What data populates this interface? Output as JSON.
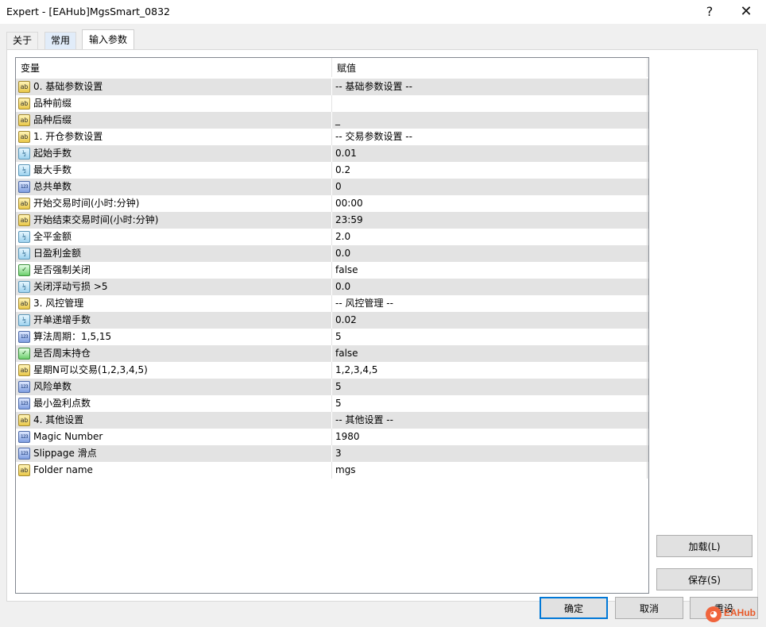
{
  "window": {
    "title": "Expert - [EAHub]MgsSmart_0832",
    "help_glyph": "?",
    "close_glyph": "✕"
  },
  "tabs": [
    {
      "label": "关于"
    },
    {
      "label": "常用"
    },
    {
      "label": "输入参数"
    }
  ],
  "grid": {
    "columns": {
      "variable": "变量",
      "value": "赋值"
    },
    "rows": [
      {
        "type": "string",
        "icon": "ab-icon",
        "name": "0. 基础参数设置",
        "value": "-- 基础参数设置 --"
      },
      {
        "type": "string",
        "icon": "ab-icon",
        "name": "品种前缀",
        "value": ""
      },
      {
        "type": "string",
        "icon": "ab-icon",
        "name": "品种后缀",
        "value": "_"
      },
      {
        "type": "string",
        "icon": "ab-icon",
        "name": "1. 开仓参数设置",
        "value": "-- 交易参数设置 --"
      },
      {
        "type": "double",
        "icon": "double-icon",
        "name": "起始手数",
        "value": "0.01"
      },
      {
        "type": "double",
        "icon": "double-icon",
        "name": "最大手数",
        "value": "0.2"
      },
      {
        "type": "int",
        "icon": "int-icon",
        "name": "总共单数",
        "value": "0"
      },
      {
        "type": "string",
        "icon": "ab-icon",
        "name": "开始交易时间(小时:分钟)",
        "value": "00:00"
      },
      {
        "type": "string",
        "icon": "ab-icon",
        "name": "开始结束交易时间(小时:分钟)",
        "value": "23:59"
      },
      {
        "type": "double",
        "icon": "double-icon",
        "name": "全平金额",
        "value": "2.0"
      },
      {
        "type": "double",
        "icon": "double-icon",
        "name": "日盈利金额",
        "value": "0.0"
      },
      {
        "type": "bool",
        "icon": "bool-icon",
        "name": "是否强制关闭",
        "value": "false"
      },
      {
        "type": "double",
        "icon": "double-icon",
        "name": "关闭浮动亏损 >5",
        "value": "0.0"
      },
      {
        "type": "string",
        "icon": "ab-icon",
        "name": "3. 风控管理",
        "value": "-- 风控管理 --"
      },
      {
        "type": "double",
        "icon": "double-icon",
        "name": "开单递增手数",
        "value": "0.02"
      },
      {
        "type": "int",
        "icon": "int-icon",
        "name": "算法周期：1,5,15",
        "value": "5"
      },
      {
        "type": "bool",
        "icon": "bool-icon",
        "name": "是否周末持仓",
        "value": "false"
      },
      {
        "type": "string",
        "icon": "ab-icon",
        "name": "星期N可以交易(1,2,3,4,5)",
        "value": "1,2,3,4,5"
      },
      {
        "type": "int",
        "icon": "int-icon",
        "name": "风险单数",
        "value": "5"
      },
      {
        "type": "int",
        "icon": "int-icon",
        "name": "最小盈利点数",
        "value": "5"
      },
      {
        "type": "string",
        "icon": "ab-icon",
        "name": "4. 其他设置",
        "value": "-- 其他设置 --"
      },
      {
        "type": "int",
        "icon": "int-icon",
        "name": "Magic Number",
        "value": "1980"
      },
      {
        "type": "int",
        "icon": "int-icon",
        "name": "Slippage 滑点",
        "value": "3"
      },
      {
        "type": "string",
        "icon": "ab-icon",
        "name": "Folder name",
        "value": "mgs"
      }
    ]
  },
  "icon_glyphs": {
    "string": "ab",
    "double": "½",
    "int": "123",
    "bool": "✓"
  },
  "buttons": {
    "load": "加载(L)",
    "save": "保存(S)",
    "ok": "确定",
    "cancel": "取消",
    "reset": "重设"
  },
  "watermark": {
    "text": "EAHub",
    "logo_glyph": "◕"
  },
  "colors": {
    "accent": "#0078d7",
    "row_alt": "#e3e3e3",
    "watermark": "#e85a2a"
  }
}
